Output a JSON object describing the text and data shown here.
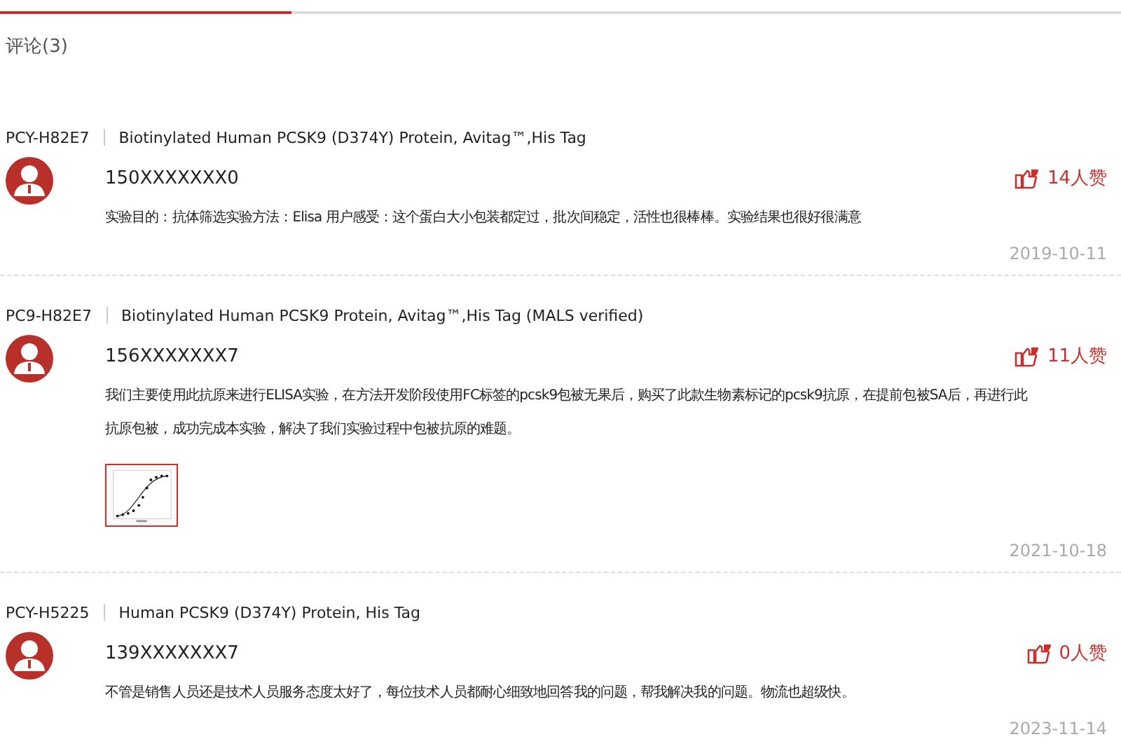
{
  "heading": {
    "label": "评论",
    "count": "(3)"
  },
  "comments": [
    {
      "code": "PCY-H82E7",
      "product": "Biotinylated Human PCSK9 (D374Y) Protein, Avitag™,His Tag",
      "user": "150XXXXXXX0",
      "likes": "14人赞",
      "lines": [
        "实验目的：抗体筛选实验方法：Elisa 用户感受：这个蛋白大小包装都定过，批次间稳定，活性也很棒棒。实验结果也很好很满意"
      ],
      "date": "2019-10-11"
    },
    {
      "code": "PC9-H82E7",
      "product": "Biotinylated Human PCSK9 Protein, Avitag™,His Tag (MALS verified)",
      "user": "156XXXXXXX7",
      "likes": "11人赞",
      "lines": [
        "我们主要使用此抗原来进行ELISA实验，在方法开发阶段使用FC标签的pcsk9包被无果后，购买了此款生物素标记的pcsk9抗原，在提前包被SA后，再进行此",
        "抗原包被，成功完成本实验，解决了我们实验过程中包被抗原的难题。"
      ],
      "image": {
        "kind": "picture"
      },
      "date": "2021-10-18"
    },
    {
      "code": "PCY-H5225",
      "product": "Human PCSK9 (D374Y) Protein, His Tag",
      "user": "139XXXXXXX7",
      "likes": "0人赞",
      "lines": [
        "不管是销售人员还是技术人员服务态度太好了，每位技术人员都耐心细致地回答我的问题，帮我解决我的问题。物流也超级快。"
      ],
      "date": "2023-11-14"
    }
  ]
}
